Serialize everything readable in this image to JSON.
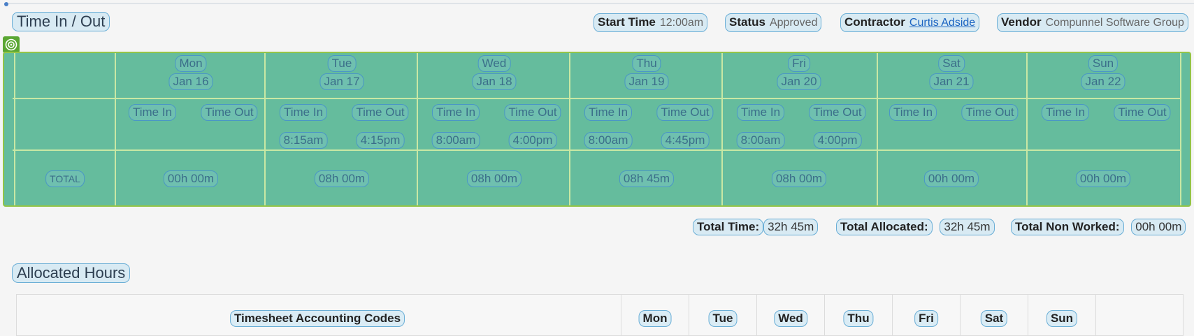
{
  "section_title": "Time In / Out",
  "meta": {
    "start_time": {
      "label": "Start Time",
      "value": "12:00am"
    },
    "status": {
      "label": "Status",
      "value": "Approved"
    },
    "contractor": {
      "label": "Contractor",
      "value": "Curtis Adside"
    },
    "vendor": {
      "label": "Vendor",
      "value": "Compunnel Software Group"
    }
  },
  "days": [
    {
      "day": "Mon",
      "date": "Jan 16",
      "time_in_label": "Time In",
      "time_out_label": "Time Out",
      "time_in": "",
      "time_out": "",
      "total": "00h 00m"
    },
    {
      "day": "Tue",
      "date": "Jan 17",
      "time_in_label": "Time In",
      "time_out_label": "Time Out",
      "time_in": "8:15am",
      "time_out": "4:15pm",
      "total": "08h 00m"
    },
    {
      "day": "Wed",
      "date": "Jan 18",
      "time_in_label": "Time In",
      "time_out_label": "Time Out",
      "time_in": "8:00am",
      "time_out": "4:00pm",
      "total": "08h 00m"
    },
    {
      "day": "Thu",
      "date": "Jan 19",
      "time_in_label": "Time In",
      "time_out_label": "Time Out",
      "time_in": "8:00am",
      "time_out": "4:45pm",
      "total": "08h 45m"
    },
    {
      "day": "Fri",
      "date": "Jan 20",
      "time_in_label": "Time In",
      "time_out_label": "Time Out",
      "time_in": "8:00am",
      "time_out": "4:00pm",
      "total": "08h 00m"
    },
    {
      "day": "Sat",
      "date": "Jan 21",
      "time_in_label": "Time In",
      "time_out_label": "Time Out",
      "time_in": "",
      "time_out": "",
      "total": "00h 00m"
    },
    {
      "day": "Sun",
      "date": "Jan 22",
      "time_in_label": "Time In",
      "time_out_label": "Time Out",
      "time_in": "",
      "time_out": "",
      "total": "00h 00m"
    }
  ],
  "total_row_label": "TOTAL",
  "totals": {
    "total_time": {
      "label": "Total Time:",
      "value": "32h 45m"
    },
    "total_allocated": {
      "label": "Total Allocated:",
      "value": "32h 45m"
    },
    "total_non_worked": {
      "label": "Total Non Worked:",
      "value": "00h 00m"
    }
  },
  "allocated_title": "Allocated Hours",
  "allocated_table": {
    "codes_header": "Timesheet Accounting Codes",
    "day_headers": [
      "Mon",
      "Tue",
      "Wed",
      "Thu",
      "Fri",
      "Sat",
      "Sun"
    ]
  },
  "colors": {
    "grid_fill": "#65bc9d",
    "grid_border": "#93c447",
    "link": "#1b64c2"
  }
}
